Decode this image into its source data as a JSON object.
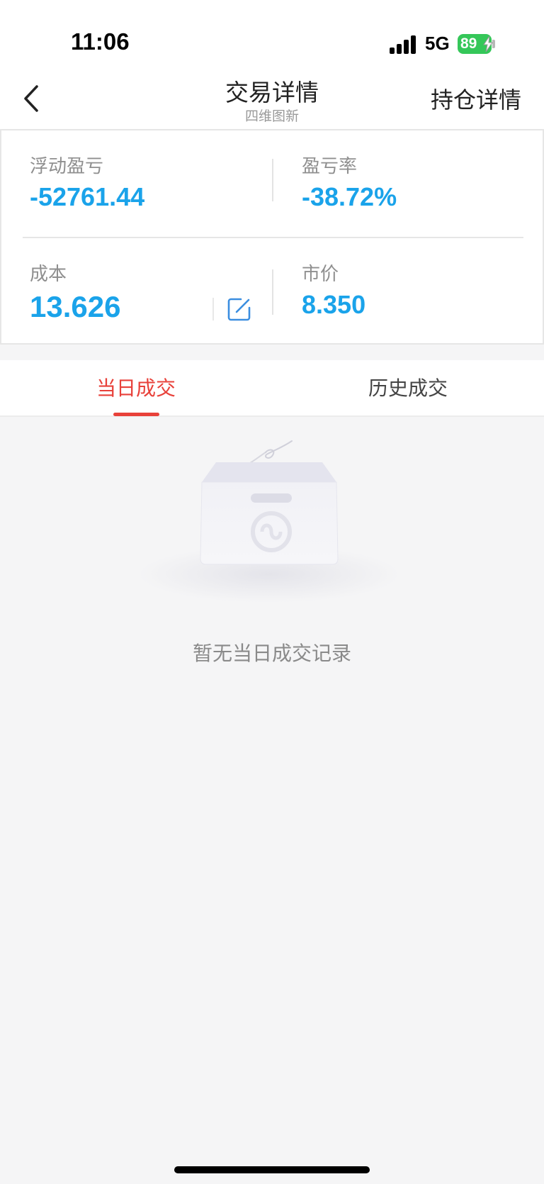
{
  "status_bar": {
    "time": "11:06",
    "network": "5G",
    "battery": "89",
    "icons": [
      "signal-icon",
      "battery-charging-icon"
    ]
  },
  "nav": {
    "title": "交易详情",
    "subtitle": "四维图新",
    "right_action": "持仓详情",
    "back_icon": "chevron-left-icon"
  },
  "summary": {
    "floating_pnl": {
      "label": "浮动盈亏",
      "value": "-52761.44"
    },
    "pnl_rate": {
      "label": "盈亏率",
      "value": "-38.72%"
    },
    "cost": {
      "label": "成本",
      "value": "13.626"
    },
    "market_price": {
      "label": "市价",
      "value": "8.350"
    },
    "edit_icon": "edit-icon",
    "value_color": "#1aa3ea"
  },
  "tabs": [
    {
      "label": "当日成交",
      "active": true
    },
    {
      "label": "历史成交",
      "active": false
    }
  ],
  "accent_color": "#e8413a",
  "empty_state": {
    "message": "暂无当日成交记录",
    "icon": "empty-box-icon"
  }
}
